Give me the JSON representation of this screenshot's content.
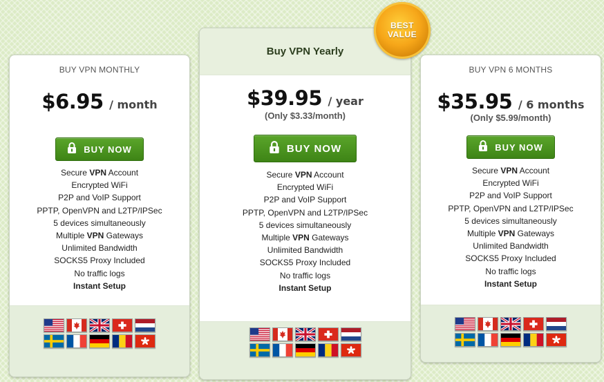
{
  "colors": {
    "background": "#dcebc6",
    "buy_button": "#4a9a21",
    "badge": "#f6a619",
    "featured_header": "#e8f0de"
  },
  "badge": {
    "line1": "BEST",
    "line2": "VALUE"
  },
  "plans": [
    {
      "title": "BUY VPN MONTHLY",
      "price": "$6.95",
      "period": "/ month",
      "subprice": "",
      "button_label": "BUY NOW",
      "button_icon": "lock-icon",
      "features": [
        {
          "pre": "Secure ",
          "bold": "VPN",
          "post": " Account"
        },
        {
          "pre": "Encrypted WiFi",
          "bold": "",
          "post": ""
        },
        {
          "pre": "P2P and VoIP Support",
          "bold": "",
          "post": ""
        },
        {
          "pre": "PPTP, OpenVPN and L2TP/IPSec",
          "bold": "",
          "post": ""
        },
        {
          "pre": "5 devices simultaneously",
          "bold": "",
          "post": ""
        },
        {
          "pre": "Multiple ",
          "bold": "VPN",
          "post": " Gateways"
        },
        {
          "pre": "Unlimited Bandwidth",
          "bold": "",
          "post": ""
        },
        {
          "pre": "SOCKS5 Proxy Included",
          "bold": "",
          "post": ""
        },
        {
          "pre": "No traffic logs",
          "bold": "",
          "post": ""
        },
        {
          "pre": "",
          "bold": "Instant Setup",
          "post": ""
        }
      ]
    },
    {
      "title": "Buy VPN Yearly",
      "price": "$39.95",
      "period": "/ year",
      "subprice": "(Only $3.33/month)",
      "button_label": "BUY NOW",
      "button_icon": "lock-icon",
      "features": [
        {
          "pre": "Secure ",
          "bold": "VPN",
          "post": " Account"
        },
        {
          "pre": "Encrypted WiFi",
          "bold": "",
          "post": ""
        },
        {
          "pre": "P2P and VoIP Support",
          "bold": "",
          "post": ""
        },
        {
          "pre": "PPTP, OpenVPN and L2TP/IPSec",
          "bold": "",
          "post": ""
        },
        {
          "pre": "5 devices simultaneously",
          "bold": "",
          "post": ""
        },
        {
          "pre": "Multiple ",
          "bold": "VPN",
          "post": " Gateways"
        },
        {
          "pre": "Unlimited Bandwidth",
          "bold": "",
          "post": ""
        },
        {
          "pre": "SOCKS5 Proxy Included",
          "bold": "",
          "post": ""
        },
        {
          "pre": "No traffic logs",
          "bold": "",
          "post": ""
        },
        {
          "pre": "",
          "bold": "Instant Setup",
          "post": ""
        }
      ]
    },
    {
      "title": "BUY VPN 6 MONTHS",
      "price": "$35.95",
      "period": "/ 6 months",
      "subprice": "(Only $5.99/month)",
      "button_label": "BUY NOW",
      "button_icon": "lock-icon",
      "features": [
        {
          "pre": "Secure ",
          "bold": "VPN",
          "post": " Account"
        },
        {
          "pre": "Encrypted WiFi",
          "bold": "",
          "post": ""
        },
        {
          "pre": "P2P and VoIP Support",
          "bold": "",
          "post": ""
        },
        {
          "pre": "PPTP, OpenVPN and L2TP/IPSec",
          "bold": "",
          "post": ""
        },
        {
          "pre": "5 devices simultaneously",
          "bold": "",
          "post": ""
        },
        {
          "pre": "Multiple ",
          "bold": "VPN",
          "post": " Gateways"
        },
        {
          "pre": "Unlimited Bandwidth",
          "bold": "",
          "post": ""
        },
        {
          "pre": "SOCKS5 Proxy Included",
          "bold": "",
          "post": ""
        },
        {
          "pre": "No traffic logs",
          "bold": "",
          "post": ""
        },
        {
          "pre": "",
          "bold": "Instant Setup",
          "post": ""
        }
      ]
    }
  ],
  "flags": [
    "usa-flag-icon",
    "canada-flag-icon",
    "uk-flag-icon",
    "switzerland-flag-icon",
    "netherlands-flag-icon",
    "sweden-flag-icon",
    "france-flag-icon",
    "germany-flag-icon",
    "romania-flag-icon",
    "hong-kong-flag-icon"
  ]
}
